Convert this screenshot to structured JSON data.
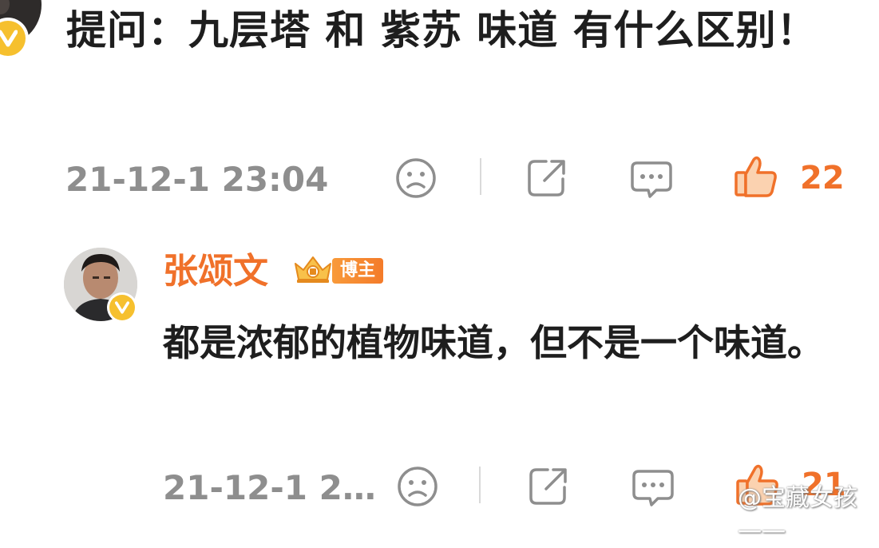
{
  "comment": {
    "text": "提问：九层塔 和 紫苏  味道 有什么区别！",
    "time": "21-12-1 23:04",
    "like_count": "22"
  },
  "reply": {
    "username": "张颂文",
    "badge_label": "博主",
    "text": "都是浓郁的植物味道，但不是一个味道。",
    "time": "21-12-1 2…",
    "like_count": "21"
  },
  "watermark": {
    "text": "@宝藏女孩一一"
  },
  "colors": {
    "accent": "#f0712a",
    "verified": "#f6c02e",
    "meta_gray": "#8e8e8e"
  },
  "icons": [
    "sad-face-icon",
    "share-icon",
    "comment-icon",
    "thumbs-up-icon",
    "verified-v-icon",
    "crown-icon",
    "weibo-logo-icon"
  ]
}
